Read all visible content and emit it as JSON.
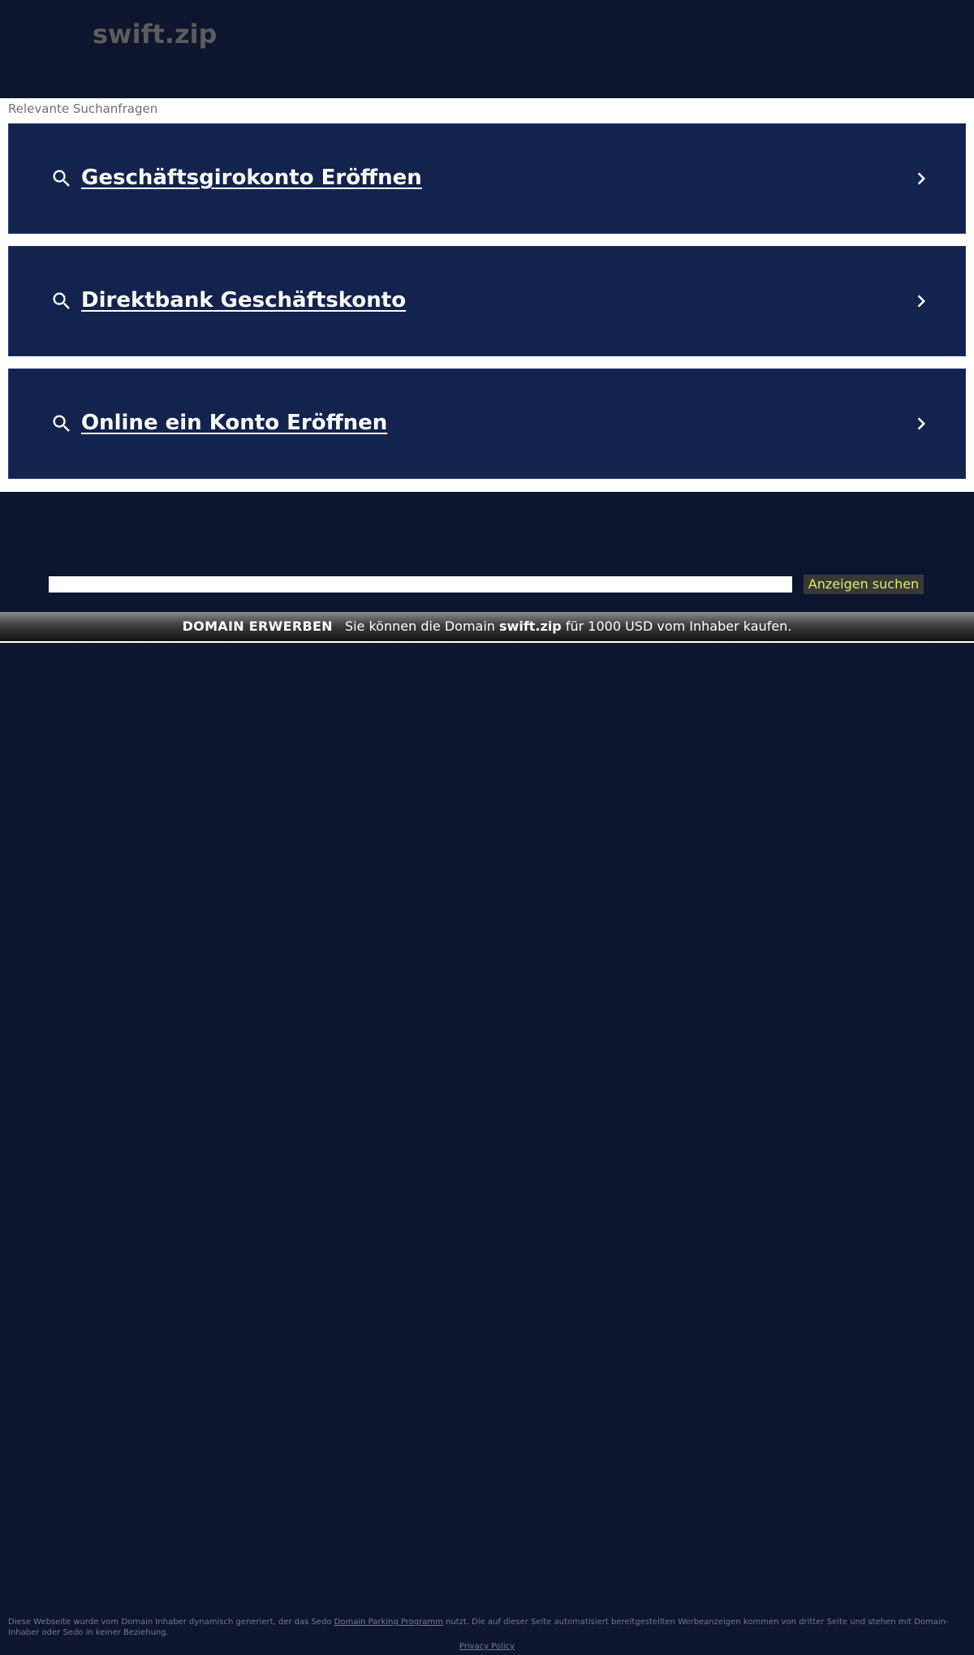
{
  "header": {
    "domain": "swift.zip"
  },
  "results": {
    "heading": "Relevante Suchanfragen",
    "items": [
      {
        "label": "Geschäftsgirokonto Eröffnen"
      },
      {
        "label": "Direktbank Geschäftskonto"
      },
      {
        "label": "Online ein Konto Eröffnen"
      }
    ]
  },
  "search": {
    "value": "",
    "button_label": "Anzeigen suchen"
  },
  "banner": {
    "title": "DOMAIN ERWERBEN",
    "text_before": "Sie können die Domain ",
    "domain": "swift.zip",
    "text_after": " für 1000 USD vom Inhaber kaufen."
  },
  "footer": {
    "text_before": "Diese Webseite wurde vom Domain Inhaber dynamisch generiert, der das Sedo ",
    "link_label": "Domain Parking Programm",
    "text_after": " nutzt. Die auf dieser Seite automatisiert bereitgestellten Werbeanzeigen kommen von dritter Seite und stehen mit Domain-Inhaber oder Sedo in keiner Beziehung.",
    "privacy_label": "Privacy Policy"
  },
  "colors": {
    "background": "#0e152e",
    "result_background": "#12234e",
    "button_text": "#e3e86a"
  }
}
